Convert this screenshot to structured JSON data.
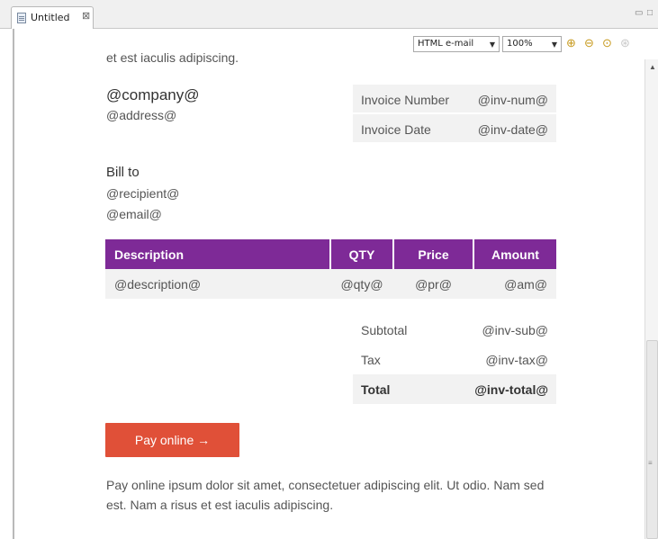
{
  "editor": {
    "tab_label": "Untitled",
    "tab_close": "⊠",
    "minimize": "▭",
    "maximize": "□"
  },
  "toolbar": {
    "format_select": "HTML e-mail",
    "zoom_select": "100%",
    "dropdown_arrow": "▼"
  },
  "document": {
    "cut_off_text": "et est iaculis adipiscing.",
    "company": "@company@",
    "address": "@address@",
    "invoice_meta": [
      {
        "label": "Invoice Number",
        "value": "@inv-num@"
      },
      {
        "label": "Invoice Date",
        "value": "@inv-date@"
      }
    ],
    "bill_to_label": "Bill to",
    "recipient": "@recipient@",
    "email": "@email@",
    "items_table": {
      "headers": [
        "Description",
        "QTY",
        "Price",
        "Amount"
      ],
      "rows": [
        [
          "@description@",
          "@qty@",
          "@pr@",
          "@am@"
        ]
      ]
    },
    "totals": [
      {
        "label": "Subtotal",
        "value": "@inv-sub@"
      },
      {
        "label": "Tax",
        "value": "@inv-tax@"
      },
      {
        "label": "Total",
        "value": "@inv-total@"
      }
    ],
    "pay_button": "Pay online →",
    "pay_text": "Pay online ipsum dolor sit amet, consectetuer adipiscing elit. Ut odio. Nam sed est. Nam a risus et est iaculis adipiscing."
  },
  "colors": {
    "table_header": "#7e2a97",
    "pay_button": "#e05038",
    "row_bg": "#f2f2f2"
  }
}
